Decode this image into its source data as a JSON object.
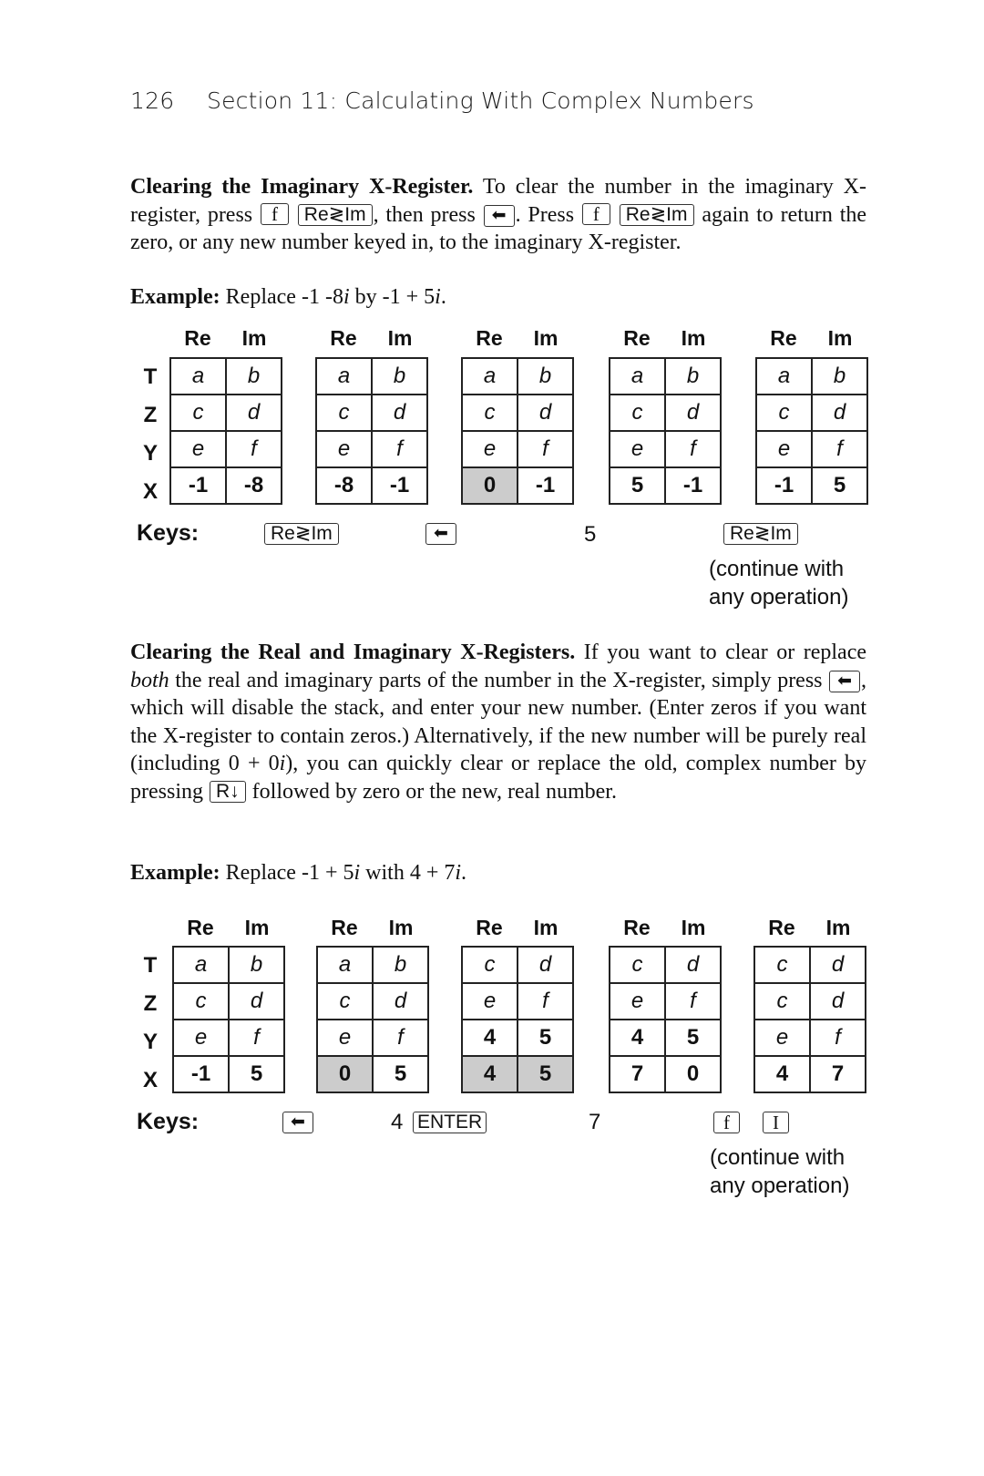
{
  "header": {
    "page_number": "126",
    "section_title": "Section 11: Calculating With Complex Numbers"
  },
  "section1": {
    "heading": "Clearing the Imaginary X-Register.",
    "text_1": " To clear the number in the imaginary X-register, press ",
    "key_f": "f",
    "key_reim": "Re≷Im",
    "text_2": ", then press ",
    "key_back": "⬅",
    "text_3": ". Press ",
    "text_4": " again to return the zero, or any new number keyed in, to the imaginary X-register."
  },
  "example1": {
    "label": "Example:",
    "text_a": " Replace -1 -8",
    "i1": "i",
    "text_b": " by -1 + 5",
    "i2": "i",
    "text_c": ".",
    "row_labels": [
      "T",
      "Z",
      "Y",
      "X"
    ],
    "col_re": "Re",
    "col_im": "Im",
    "stacks": [
      {
        "rows": [
          [
            "a",
            "b"
          ],
          [
            "c",
            "d"
          ],
          [
            "e",
            "f"
          ],
          [
            "-1",
            "-8"
          ]
        ],
        "highlight": []
      },
      {
        "rows": [
          [
            "a",
            "b"
          ],
          [
            "c",
            "d"
          ],
          [
            "e",
            "f"
          ],
          [
            "-8",
            "-1"
          ]
        ],
        "highlight": []
      },
      {
        "rows": [
          [
            "a",
            "b"
          ],
          [
            "c",
            "d"
          ],
          [
            "e",
            "f"
          ],
          [
            "0",
            "-1"
          ]
        ],
        "highlight": [
          "3-0"
        ]
      },
      {
        "rows": [
          [
            "a",
            "b"
          ],
          [
            "c",
            "d"
          ],
          [
            "e",
            "f"
          ],
          [
            "5",
            "-1"
          ]
        ],
        "highlight": []
      },
      {
        "rows": [
          [
            "a",
            "b"
          ],
          [
            "c",
            "d"
          ],
          [
            "e",
            "f"
          ],
          [
            "-1",
            "5"
          ]
        ],
        "highlight": []
      }
    ],
    "keys_label": "Keys:",
    "keys": [
      {
        "type": "key",
        "label": "Re≷Im"
      },
      {
        "type": "key-arrow",
        "label": "⬅"
      },
      {
        "type": "text",
        "label": "5"
      },
      {
        "type": "key",
        "label": "Re≷Im"
      }
    ],
    "continue_line1": "(continue with",
    "continue_line2": "any operation)"
  },
  "section2": {
    "heading": "Clearing the Real and Imaginary X-Registers.",
    "text_1": " If you want to clear or replace ",
    "both": "both",
    "text_2": " the real and imaginary parts of the number in the X-register, simply press ",
    "key_back": "⬅",
    "text_3": ", which will disable the stack, and enter your new number. (Enter zeros if you want the X-register to contain zeros.) Alternatively, if the new number will be purely real (including 0 + 0",
    "i": "i",
    "text_4": "), you can quickly clear or replace the old, complex number by pressing ",
    "key_rdown": "R↓",
    "text_5": " followed by zero or the new, real number."
  },
  "example2": {
    "label": "Example:",
    "text_a": " Replace -1 + 5",
    "i1": "i",
    "text_b": " with 4 + 7",
    "i2": "i",
    "text_c": ".",
    "row_labels": [
      "T",
      "Z",
      "Y",
      "X"
    ],
    "col_re": "Re",
    "col_im": "Im",
    "stacks": [
      {
        "rows": [
          [
            "a",
            "b"
          ],
          [
            "c",
            "d"
          ],
          [
            "e",
            "f"
          ],
          [
            "-1",
            "5"
          ]
        ],
        "highlight": []
      },
      {
        "rows": [
          [
            "a",
            "b"
          ],
          [
            "c",
            "d"
          ],
          [
            "e",
            "f"
          ],
          [
            "0",
            "5"
          ]
        ],
        "highlight": [
          "3-0"
        ]
      },
      {
        "rows": [
          [
            "c",
            "d"
          ],
          [
            "e",
            "f"
          ],
          [
            "4",
            "5"
          ],
          [
            "4",
            "5"
          ]
        ],
        "highlight": [
          "3-0",
          "3-1"
        ]
      },
      {
        "rows": [
          [
            "c",
            "d"
          ],
          [
            "e",
            "f"
          ],
          [
            "4",
            "5"
          ],
          [
            "7",
            "0"
          ]
        ],
        "highlight": []
      },
      {
        "rows": [
          [
            "c",
            "d"
          ],
          [
            "c",
            "d"
          ],
          [
            "e",
            "f"
          ],
          [
            "4",
            "7"
          ]
        ],
        "highlight": []
      }
    ],
    "keys_label": "Keys:",
    "key_back": "⬅",
    "key_4": "4",
    "key_enter": "ENTER",
    "key_7": "7",
    "key_f": "f",
    "key_I": "I",
    "continue_line1": "(continue with",
    "continue_line2": "any operation)"
  }
}
